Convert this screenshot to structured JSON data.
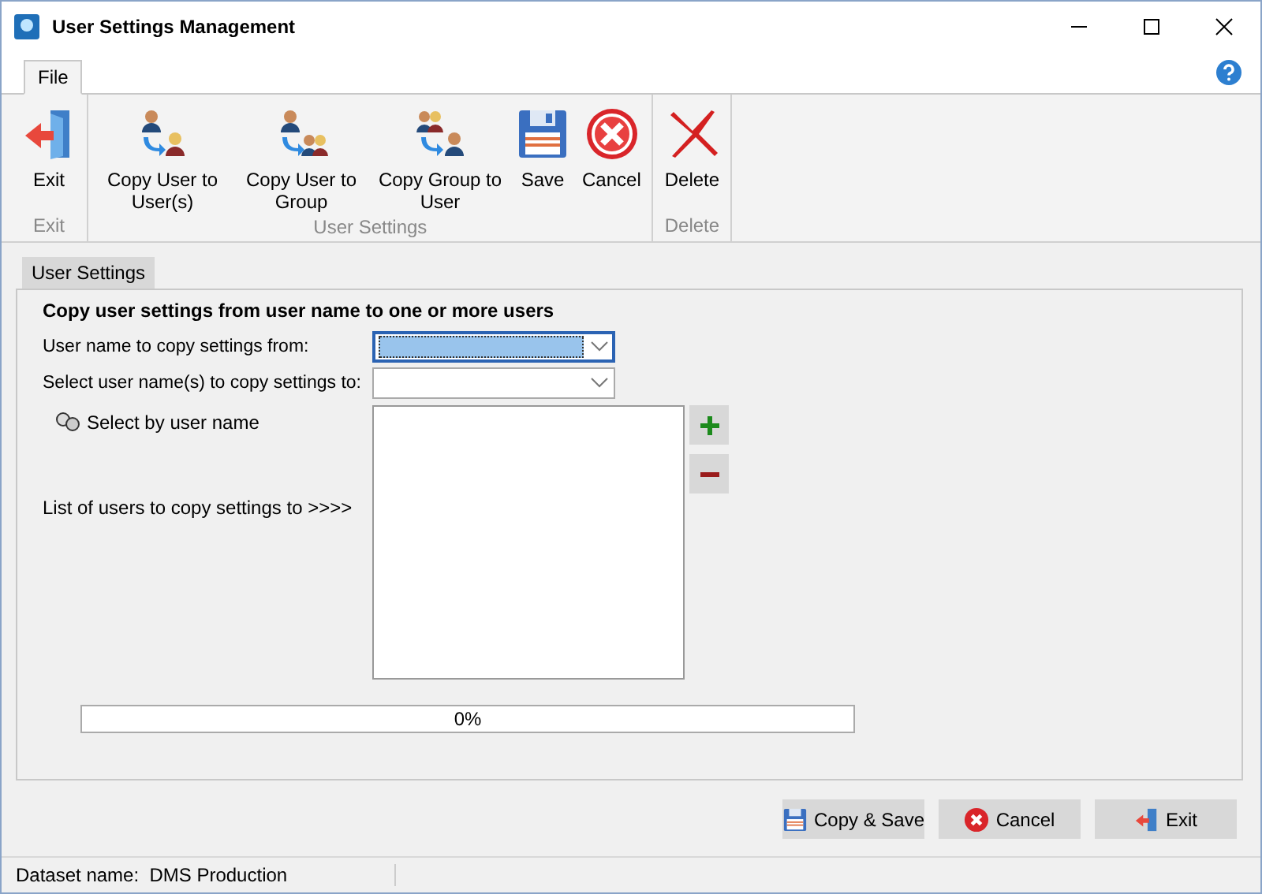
{
  "window": {
    "title": "User Settings Management"
  },
  "menu_tabs": [
    {
      "label": "File",
      "selected": true
    }
  ],
  "ribbon": {
    "groups": [
      {
        "label": "Exit",
        "buttons": [
          {
            "label": "Exit",
            "kind": "exit"
          }
        ]
      },
      {
        "label": "User Settings",
        "buttons": [
          {
            "label": "Copy User to User(s)",
            "kind": "user-to-user"
          },
          {
            "label": "Copy User to Group",
            "kind": "user-to-group"
          },
          {
            "label": "Copy Group to User",
            "kind": "group-to-user"
          },
          {
            "label": "Save",
            "kind": "save"
          },
          {
            "label": "Cancel",
            "kind": "cancel"
          }
        ]
      },
      {
        "label": "Delete",
        "buttons": [
          {
            "label": "Delete",
            "kind": "delete"
          }
        ]
      }
    ]
  },
  "page_tabs": [
    {
      "label": "User Settings",
      "selected": true
    }
  ],
  "form": {
    "heading": "Copy user settings from user name to one or more users",
    "fields": [
      {
        "label": "User name to copy settings from:",
        "focused": true
      },
      {
        "label": "Select user name(s) to copy settings to:",
        "focused": false
      }
    ],
    "select_by": "Select by user name",
    "list_label": "List of users to copy settings to >>>>",
    "progress": {
      "level": 0,
      "text": "0%"
    }
  },
  "buttons": [
    {
      "label": "Copy & Save",
      "kind": "save"
    },
    {
      "label": "Cancel",
      "kind": "cancel"
    },
    {
      "label": "Exit",
      "kind": "exit"
    }
  ],
  "status_bar": {
    "dataset": "Dataset name:  DMS Production"
  }
}
